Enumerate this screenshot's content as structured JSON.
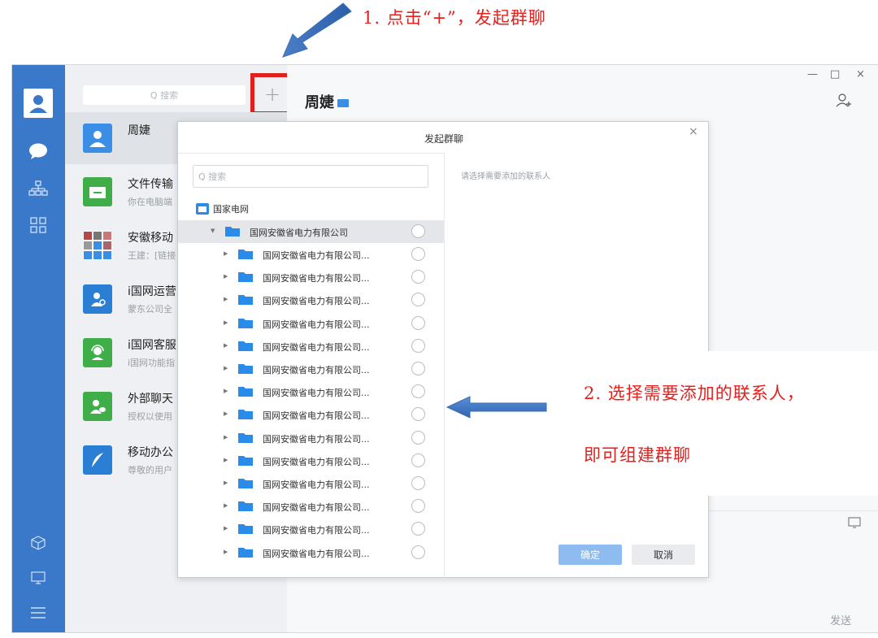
{
  "annotations": {
    "step1": "1. 点击“+”，发起群聊",
    "step2_line1": "2. 选择需要添加的联系人，",
    "step2_line2": "即可组建群聊"
  },
  "sidebar": {
    "search_placeholder": "Q 搜索",
    "plus_label": "+",
    "conversations": [
      {
        "name": "周婕",
        "sub": ""
      },
      {
        "name": "文件传输",
        "sub": "你在电脑端"
      },
      {
        "name": "安徽移动",
        "sub": "王建：[链接"
      },
      {
        "name": "i国网运营",
        "sub": "蒙东公司全"
      },
      {
        "name": "i国网客服",
        "sub": "i国网功能指"
      },
      {
        "name": "外部聊天",
        "sub": "授权以使用"
      },
      {
        "name": "移动办公",
        "sub": "尊敬的用户"
      }
    ]
  },
  "chat": {
    "title": "周婕",
    "window_controls": {
      "minimize": "—",
      "maximize": "□",
      "close": "×"
    },
    "send_label": "发送"
  },
  "dialog": {
    "title": "发起群聊",
    "close": "×",
    "search_placeholder": "Q 搜索",
    "root": "国家电网",
    "org": "国网安徽省电力有限公司",
    "children": [
      "国网安徽省电力有限公司...",
      "国网安徽省电力有限公司...",
      "国网安徽省电力有限公司...",
      "国网安徽省电力有限公司...",
      "国网安徽省电力有限公司...",
      "国网安徽省电力有限公司...",
      "国网安徽省电力有限公司...",
      "国网安徽省电力有限公司...",
      "国网安徽省电力有限公司...",
      "国网安徽省电力有限公司...",
      "国网安徽省电力有限公司...",
      "国网安徽省电力有限公司...",
      "国网安徽省电力有限公司...",
      "国网安徽省电力有限公司..."
    ],
    "right_hint": "请选择需要添加的联系人",
    "ok_label": "确定",
    "cancel_label": "取消"
  },
  "colors": {
    "rail": "#3a78c9",
    "annotation_red": "#e5201d",
    "highlight_box": "#e0201c",
    "folder_blue": "#2b8be8",
    "ok_button": "#8fbcf0"
  }
}
